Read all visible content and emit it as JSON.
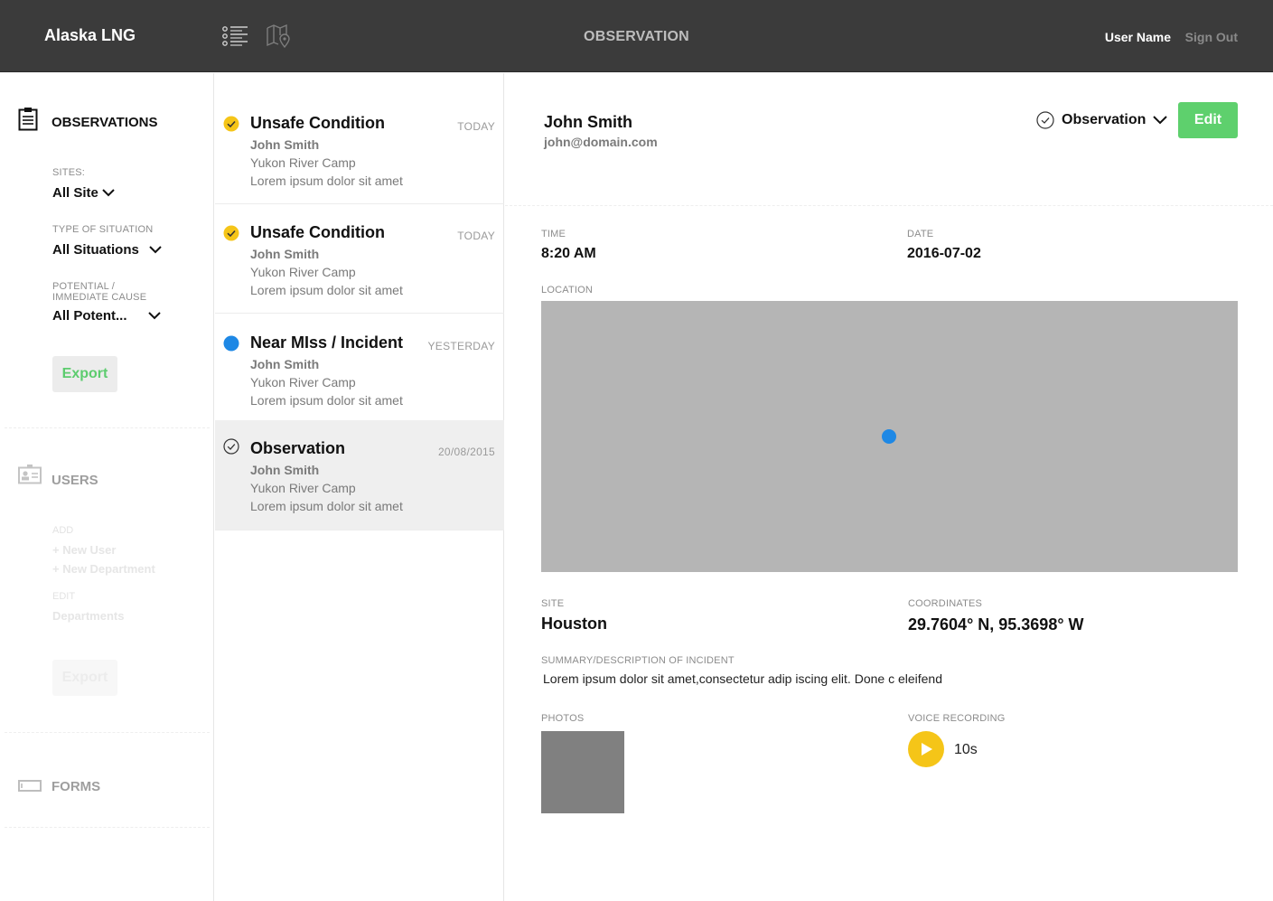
{
  "app": {
    "brand": "Alaska LNG",
    "page_title": "OBSERVATION",
    "user_name": "User Name",
    "sign_out": "Sign Out",
    "nav_icons": [
      "list-icon",
      "map-icon"
    ]
  },
  "sidebar": {
    "observations": {
      "title": "OBSERVATIONS",
      "icon": "clipboard-icon",
      "filters": [
        {
          "label": "SITES:",
          "value": "All Site"
        },
        {
          "label": "TYPE OF SITUATION",
          "value": "All Situations"
        },
        {
          "label": "POTENTIAL /",
          "label2": "IMMEDIATE CAUSE",
          "value": "All Potent..."
        }
      ],
      "export": "Export"
    },
    "users": {
      "title": "USERS",
      "icon": "id-card-icon",
      "add_label": "ADD",
      "new_user": "+ New User",
      "new_department": "+ New Department",
      "edit_label": "EDIT",
      "departments": "Departments",
      "export": "Export"
    },
    "forms": {
      "title": "FORMS",
      "icon": "form-icon"
    }
  },
  "list": {
    "items": [
      {
        "status": "yellow-check",
        "title": "Unsafe Condition",
        "date": "TODAY",
        "name": "John Smith",
        "location": "Yukon River Camp",
        "desc": "Lorem ipsum dolor sit amet"
      },
      {
        "status": "yellow-check",
        "title": "Unsafe Condition",
        "date": "TODAY",
        "name": "John Smith",
        "location": "Yukon River Camp",
        "desc": "Lorem ipsum dolor sit amet"
      },
      {
        "status": "blue-dot",
        "title": "Near MIss / Incident",
        "date": "YESTERDAY",
        "name": "John Smith",
        "location": "Yukon River Camp",
        "desc": "Lorem ipsum dolor sit amet"
      },
      {
        "status": "outline-check",
        "title": "Observation",
        "date": "20/08/2015",
        "name": "John Smith",
        "location": "Yukon River Camp",
        "desc": "Lorem ipsum dolor sit amet",
        "selected": true
      }
    ]
  },
  "detail": {
    "name": "John Smith",
    "email": "john@domain.com",
    "type": "Observation",
    "edit": "Edit",
    "time_label": "TIME",
    "time": "8:20 AM",
    "date_label": "DATE",
    "date": "2016-07-02",
    "location_label": "LOCATION",
    "site_label": "SITE",
    "site": "Houston",
    "coords_label": "COORDINATES",
    "coords": "29.7604° N, 95.3698° W",
    "summary_label": "SUMMARY/DESCRIPTION OF INCIDENT",
    "summary": "Lorem ipsum dolor sit amet,consectetur adip  iscing elit. Done c eleifend",
    "photos_label": "PHOTOS",
    "voice_label": "VOICE RECORDING",
    "voice_length": "10s"
  },
  "colors": {
    "topbar": "#3b3b3b",
    "accent_green": "#5ed06d",
    "status_yellow": "#f5c518",
    "status_blue": "#1e88e5",
    "map_bg": "#b5b5b5"
  }
}
